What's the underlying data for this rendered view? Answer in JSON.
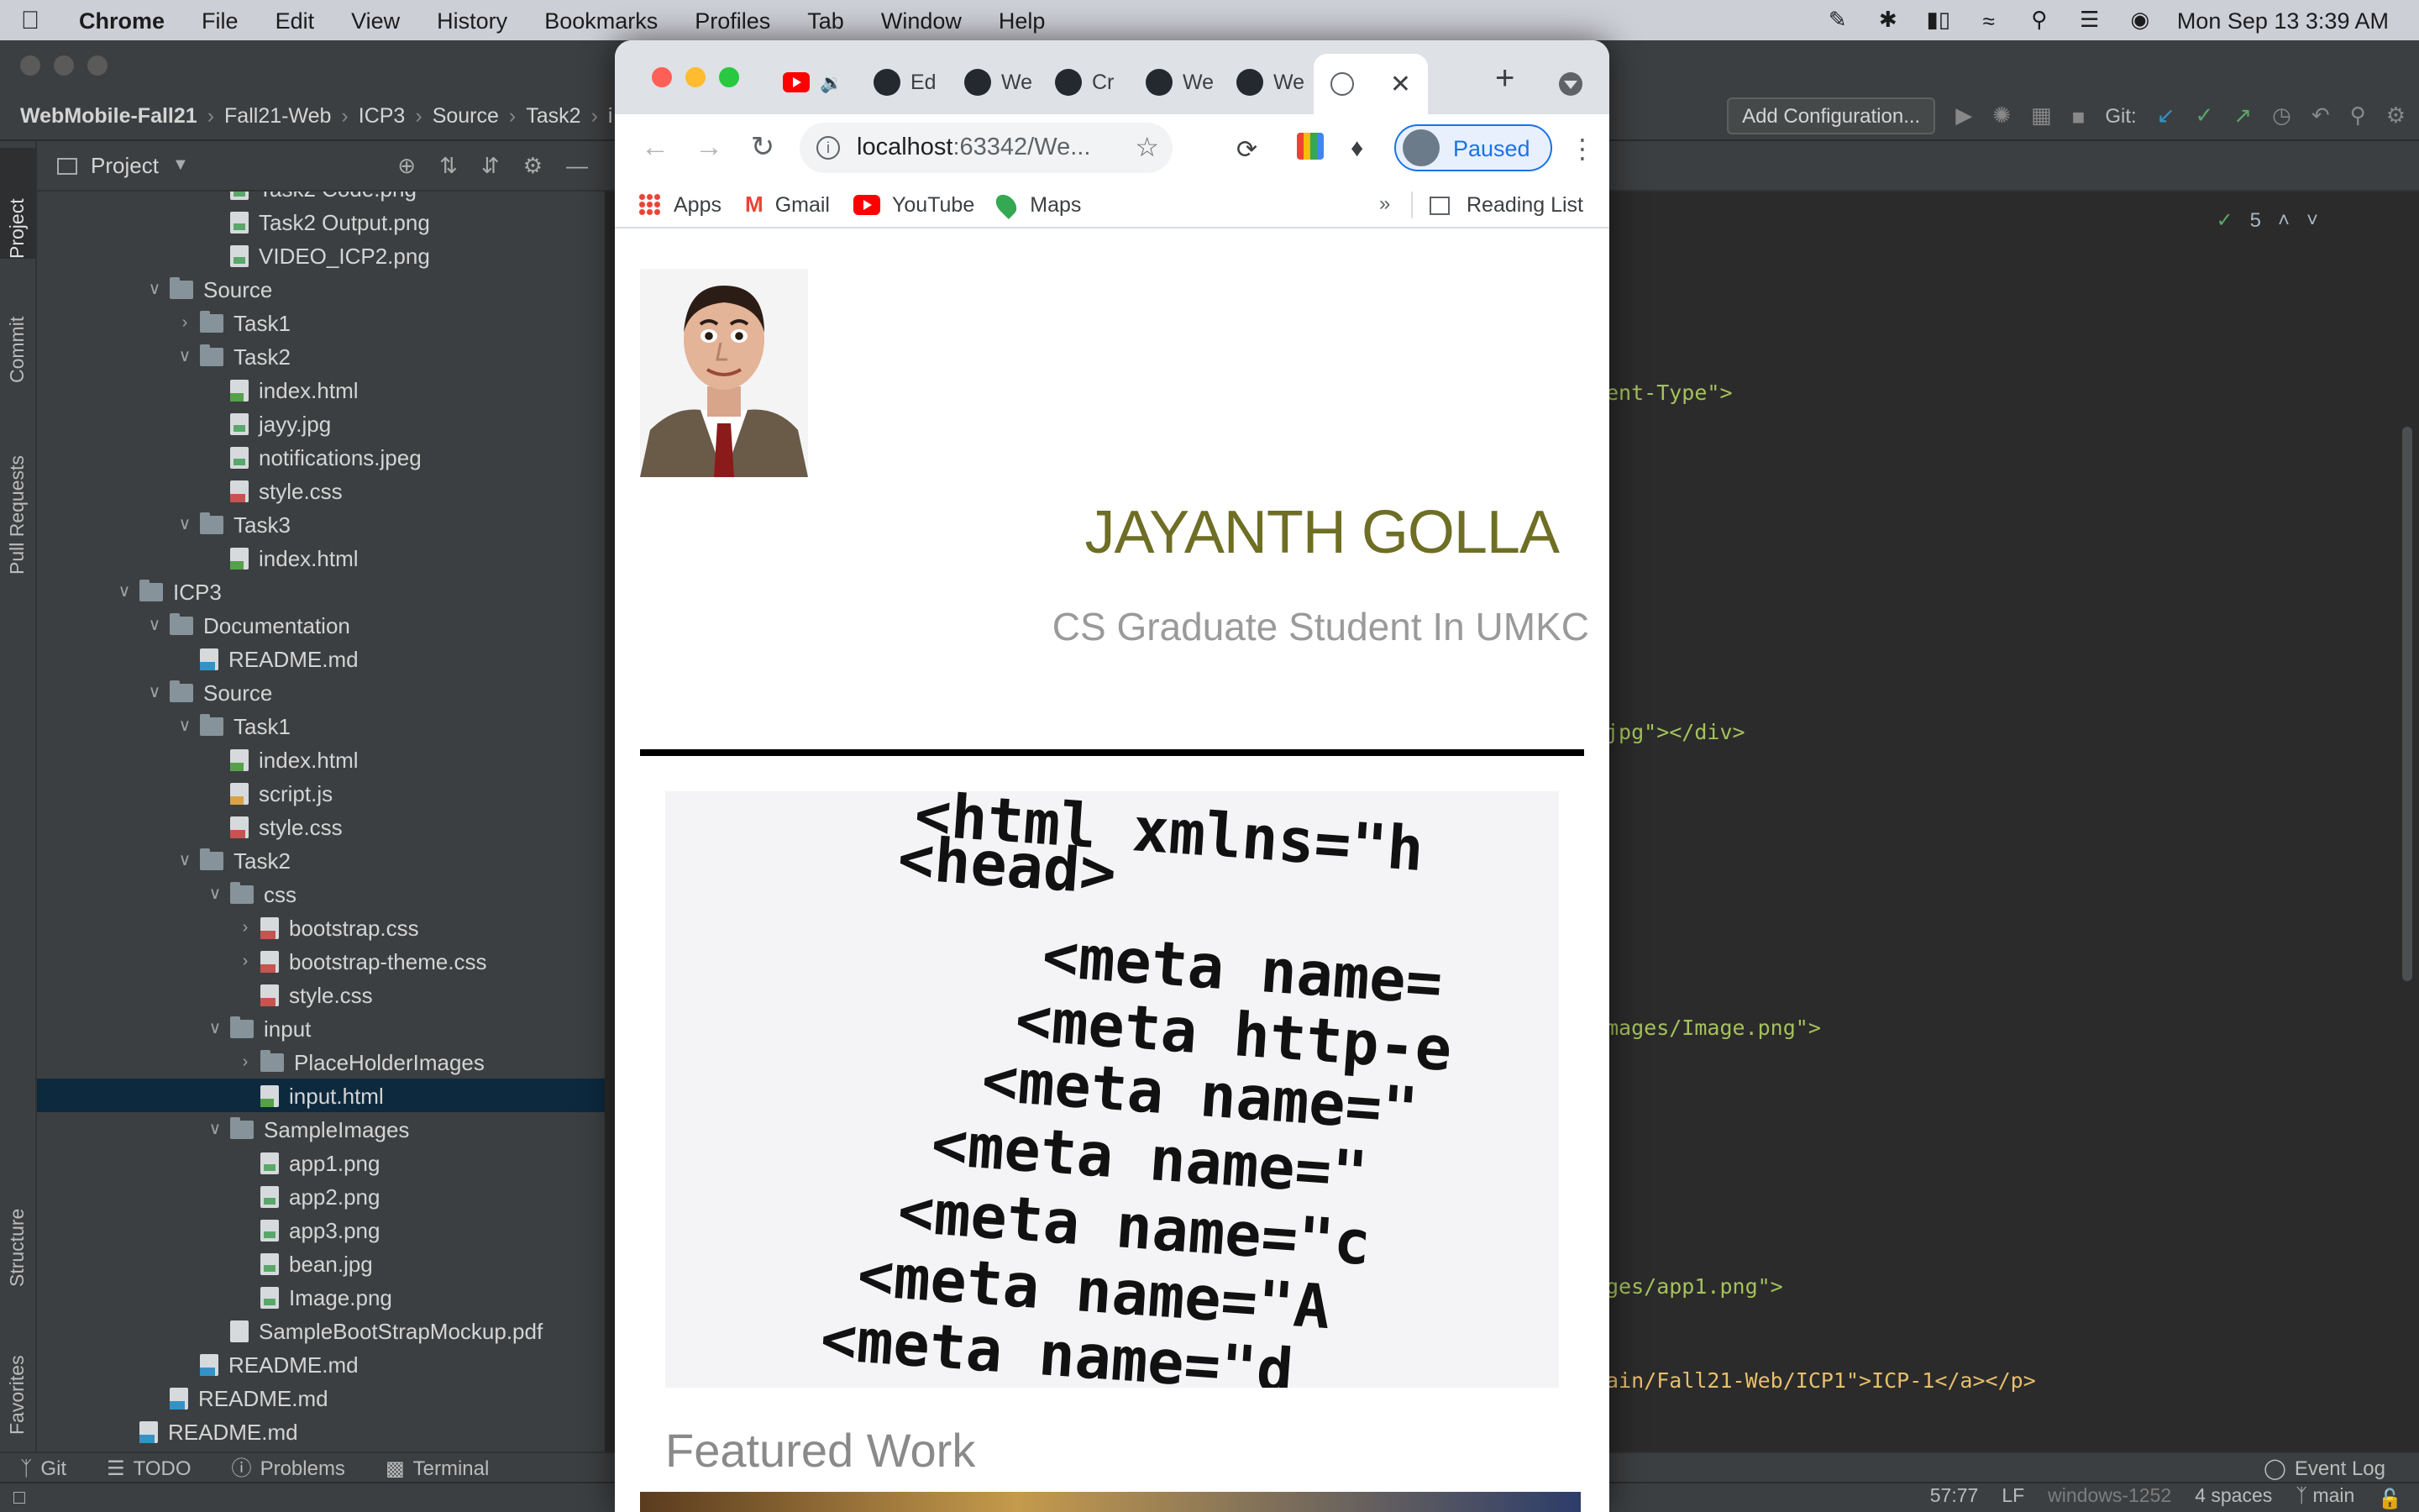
{
  "menubar": {
    "app": "Chrome",
    "items": [
      "File",
      "Edit",
      "View",
      "History",
      "Bookmarks",
      "Profiles",
      "Tab",
      "Window",
      "Help"
    ],
    "clock": "Mon Sep 13  3:39 AM"
  },
  "ide": {
    "breadcrumb": [
      "WebMobile-Fall21",
      "Fall21-Web",
      "ICP3",
      "Source",
      "Task2",
      "i"
    ],
    "add_configuration": "Add Configuration...",
    "git_label": "Git:",
    "project_label": "Project",
    "inspection_count": "5",
    "side_tabs": [
      "Project",
      "Commit",
      "Pull Requests",
      "Structure",
      "Favorites"
    ],
    "tree": [
      {
        "label": "Task2 Code.png",
        "kind": "img",
        "depth": 5,
        "arrow": ""
      },
      {
        "label": "Task2 Output.png",
        "kind": "img",
        "depth": 5,
        "arrow": ""
      },
      {
        "label": "VIDEO_ICP2.png",
        "kind": "img",
        "depth": 5,
        "arrow": ""
      },
      {
        "label": "Source",
        "kind": "folder",
        "depth": 3,
        "arrow": "open"
      },
      {
        "label": "Task1",
        "kind": "folder",
        "depth": 4,
        "arrow": "closed"
      },
      {
        "label": "Task2",
        "kind": "folder",
        "depth": 4,
        "arrow": "open"
      },
      {
        "label": "index.html",
        "kind": "html",
        "depth": 5,
        "arrow": ""
      },
      {
        "label": "jayy.jpg",
        "kind": "img",
        "depth": 5,
        "arrow": ""
      },
      {
        "label": "notifications.jpeg",
        "kind": "img",
        "depth": 5,
        "arrow": ""
      },
      {
        "label": "style.css",
        "kind": "css",
        "depth": 5,
        "arrow": ""
      },
      {
        "label": "Task3",
        "kind": "folder",
        "depth": 4,
        "arrow": "open"
      },
      {
        "label": "index.html",
        "kind": "html",
        "depth": 5,
        "arrow": ""
      },
      {
        "label": "ICP3",
        "kind": "folder",
        "depth": 2,
        "arrow": "open"
      },
      {
        "label": "Documentation",
        "kind": "folder",
        "depth": 3,
        "arrow": "open"
      },
      {
        "label": "README.md",
        "kind": "md",
        "depth": 4,
        "arrow": ""
      },
      {
        "label": "Source",
        "kind": "folder",
        "depth": 3,
        "arrow": "open"
      },
      {
        "label": "Task1",
        "kind": "folder",
        "depth": 4,
        "arrow": "open"
      },
      {
        "label": "index.html",
        "kind": "html",
        "depth": 5,
        "arrow": ""
      },
      {
        "label": "script.js",
        "kind": "js",
        "depth": 5,
        "arrow": ""
      },
      {
        "label": "style.css",
        "kind": "css",
        "depth": 5,
        "arrow": ""
      },
      {
        "label": "Task2",
        "kind": "folder",
        "depth": 4,
        "arrow": "open"
      },
      {
        "label": "css",
        "kind": "folder",
        "depth": 5,
        "arrow": "open"
      },
      {
        "label": "bootstrap.css",
        "kind": "css",
        "depth": 6,
        "arrow": "closed"
      },
      {
        "label": "bootstrap-theme.css",
        "kind": "css",
        "depth": 6,
        "arrow": "closed"
      },
      {
        "label": "style.css",
        "kind": "css",
        "depth": 6,
        "arrow": ""
      },
      {
        "label": "input",
        "kind": "folder",
        "depth": 5,
        "arrow": "open"
      },
      {
        "label": "PlaceHolderImages",
        "kind": "folder",
        "depth": 6,
        "arrow": "closed"
      },
      {
        "label": "input.html",
        "kind": "html",
        "depth": 6,
        "arrow": "",
        "selected": true
      },
      {
        "label": "SampleImages",
        "kind": "folder",
        "depth": 5,
        "arrow": "open"
      },
      {
        "label": "app1.png",
        "kind": "img",
        "depth": 6,
        "arrow": ""
      },
      {
        "label": "app2.png",
        "kind": "img",
        "depth": 6,
        "arrow": ""
      },
      {
        "label": "app3.png",
        "kind": "img",
        "depth": 6,
        "arrow": ""
      },
      {
        "label": "bean.jpg",
        "kind": "img",
        "depth": 6,
        "arrow": ""
      },
      {
        "label": "Image.png",
        "kind": "img",
        "depth": 6,
        "arrow": ""
      },
      {
        "label": "SampleBootStrapMockup.pdf",
        "kind": "file",
        "depth": 5,
        "arrow": ""
      },
      {
        "label": "README.md",
        "kind": "md",
        "depth": 4,
        "arrow": ""
      },
      {
        "label": "README.md",
        "kind": "md",
        "depth": 3,
        "arrow": ""
      },
      {
        "label": "README.md",
        "kind": "md",
        "depth": 2,
        "arrow": ""
      }
    ],
    "code_fragments": [
      {
        "text": "ent-Type\">",
        "kind": "str"
      },
      {
        "text": "jpg\"></div>",
        "kind": "mix"
      },
      {
        "text": "mages/Image.png\">",
        "kind": "str"
      },
      {
        "text": "ges/app1.png\">",
        "kind": "str"
      },
      {
        "text": "ain/Fall21-Web/ICP1\">ICP-1</a></p>",
        "kind": "mix"
      }
    ],
    "bottom_tools": [
      "Git",
      "TODO",
      "Problems",
      "Terminal"
    ],
    "event_log": "Event Log",
    "status": {
      "position": "57:77",
      "line_sep": "LF",
      "encoding": "windows-1252",
      "indent": "4 spaces",
      "branch": "main"
    }
  },
  "chrome": {
    "tabs": [
      "Ed",
      "We",
      "Cr",
      "We",
      "We"
    ],
    "url_host": "localhost",
    "url_rest": ":63342/We...",
    "profile_status": "Paused",
    "bookmarks": [
      "Apps",
      "Gmail",
      "YouTube",
      "Maps"
    ],
    "more": "»",
    "reading_list": "Reading List"
  },
  "page": {
    "name": "JAYANTH GOLLA",
    "subtitle": "CS Graduate Student In UMKC",
    "featured_heading": "Featured Work",
    "code_image_lines": [
      "<html xmlns=\"h",
      "<head>",
      "<meta name=",
      "<meta http-e",
      "<meta name=\"",
      "<meta name=\"",
      "<meta name=\"c",
      "<meta name=\"A",
      "<meta name=\"d"
    ]
  }
}
